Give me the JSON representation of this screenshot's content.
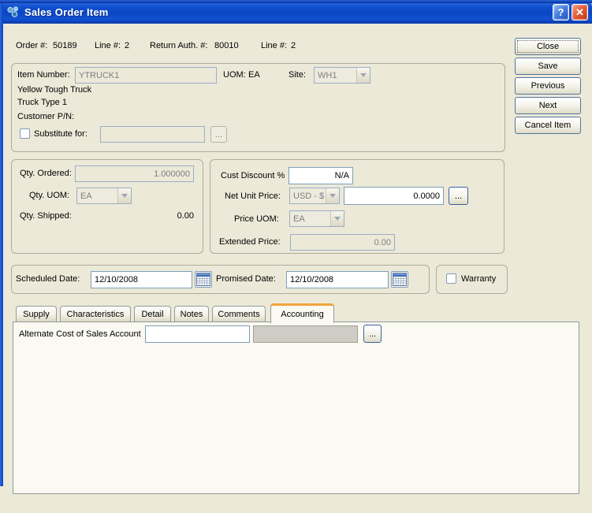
{
  "colors": {
    "titlebar_blue": "#1150CE",
    "dialog_background": "#ECE9D8",
    "active_tab_accent": "#EFA53A",
    "input_border": "#7F9DB9"
  },
  "window": {
    "title": "Sales Order Item",
    "help": "?",
    "close": "✕"
  },
  "header": {
    "order_label": "Order #:",
    "order_value": "50189",
    "line_label": "Line #:",
    "line_value": "2",
    "return_auth_label": "Return Auth. #:",
    "return_auth_value": "80010",
    "line2_label": "Line #:",
    "line2_value": "2"
  },
  "actions": {
    "close": "Close",
    "save": "Save",
    "previous": "Previous",
    "next": "Next",
    "cancel_item": "Cancel Item"
  },
  "item": {
    "item_number_label": "Item Number:",
    "item_number_value": "YTRUCK1",
    "uom_label": "UOM:",
    "uom_value": "EA",
    "site_label": "Site:",
    "site_value": "WH1",
    "description1": "Yellow Tough Truck",
    "description2": "Truck Type 1",
    "customer_pn_label": "Customer P/N:",
    "substitute_label": "Substitute for:",
    "substitute_value": "",
    "substitute_checked": false,
    "ellipsis": "..."
  },
  "quantity": {
    "ordered_label": "Qty. Ordered:",
    "ordered_value": "1.000000",
    "uom_label": "Qty. UOM:",
    "uom_value": "EA",
    "shipped_label": "Qty. Shipped:",
    "shipped_value": "0.00"
  },
  "pricing": {
    "discount_label": "Cust Discount %",
    "discount_value": "N/A",
    "net_unit_price_label": "Net Unit Price:",
    "currency_value": "USD - $",
    "net_unit_price_value": "0.0000",
    "list_price_button": "...",
    "price_uom_label": "Price UOM:",
    "price_uom_value": "EA",
    "extended_label": "Extended Price:",
    "extended_value": "0.00"
  },
  "dates": {
    "scheduled_label": "Scheduled Date:",
    "scheduled_value": "12/10/2008",
    "promised_label": "Promised Date:",
    "promised_value": "12/10/2008",
    "warranty_label": "Warranty",
    "warranty_checked": false
  },
  "tabs": [
    {
      "label": "Supply",
      "active": false
    },
    {
      "label": "Characteristics",
      "active": false
    },
    {
      "label": "Detail",
      "active": false
    },
    {
      "label": "Notes",
      "active": false
    },
    {
      "label": "Comments",
      "active": false
    },
    {
      "label": "Accounting",
      "active": true
    }
  ],
  "accounting": {
    "alt_cos_label": "Alternate Cost of Sales Account",
    "account_value": "",
    "account_description": "",
    "ellipsis": "..."
  }
}
